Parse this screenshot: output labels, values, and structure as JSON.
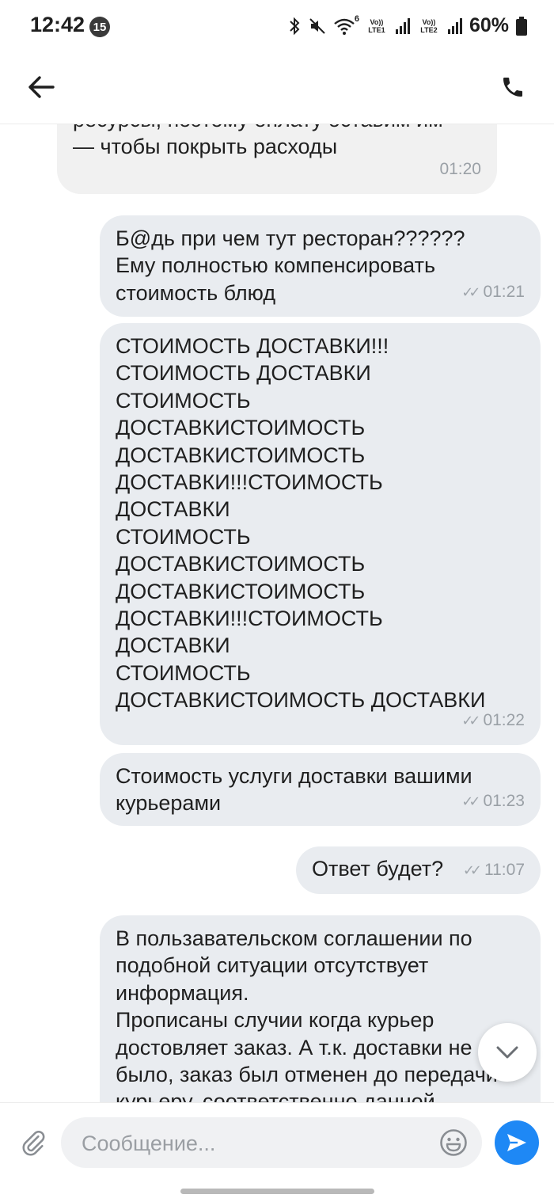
{
  "status_bar": {
    "time": "12:42",
    "notification_count": "15",
    "sim1_label": "Vo)) LTE1",
    "sim2_label": "Vo)) LTE2",
    "wifi_label": "6",
    "battery_percent": "60%"
  },
  "app_bar": {
    "back_icon": "arrow-left-icon",
    "call_icon": "phone-icon"
  },
  "messages": [
    {
      "direction": "incoming",
      "text": "ресурсы, поэтому оплату оставим им\n— чтобы покрыть расходы",
      "time": "01:20"
    },
    {
      "direction": "outgoing",
      "text": "Б@дь при чем тут ресторан??????\nЕму полностью компенсировать\nстоимость блюд",
      "time": "01:21",
      "status": "read"
    },
    {
      "direction": "outgoing",
      "text": "СТОИМОСТЬ ДОСТАВКИ!!!\nСТОИМОСТЬ ДОСТАВКИ\nСТОИМОСТЬ\nДОСТАВКИСТОИМОСТЬ\nДОСТАВКИСТОИМОСТЬ\nДОСТАВКИ!!!СТОИМОСТЬ\nДОСТАВКИ\nСТОИМОСТЬ\nДОСТАВКИСТОИМОСТЬ\nДОСТАВКИСТОИМОСТЬ\nДОСТАВКИ!!!СТОИМОСТЬ\nДОСТАВКИ\nСТОИМОСТЬ\nДОСТАВКИСТОИМОСТЬ ДОСТАВКИ",
      "time": "01:22",
      "status": "read"
    },
    {
      "direction": "outgoing",
      "text": "Стоимость услуги доставки вашими\nкурьерами",
      "time": "01:23",
      "status": "read"
    },
    {
      "direction": "outgoing",
      "text": "Ответ будет?",
      "time": "11:07",
      "status": "read"
    },
    {
      "direction": "outgoing",
      "text": "В пользавательском соглашении по\nподобной ситуации отсутствует\nинформация.\nПрописаны случии когда курьер\nдостовляет заказ. А т.к. доставки не\nбыло, заказ был отменен до передачи\nкурьеру, соответственно данной",
      "time": "",
      "status": "read"
    }
  ],
  "composer": {
    "placeholder": "Сообщение...",
    "value": "",
    "attach_icon": "paperclip-icon",
    "emoji_icon": "emoji-icon",
    "send_icon": "send-icon"
  },
  "colors": {
    "outgoing_bubble": "#e9ecf0",
    "incoming_bubble": "#f1f1f1",
    "send_button": "#1e88f5",
    "time_text": "#9aa0a6"
  }
}
